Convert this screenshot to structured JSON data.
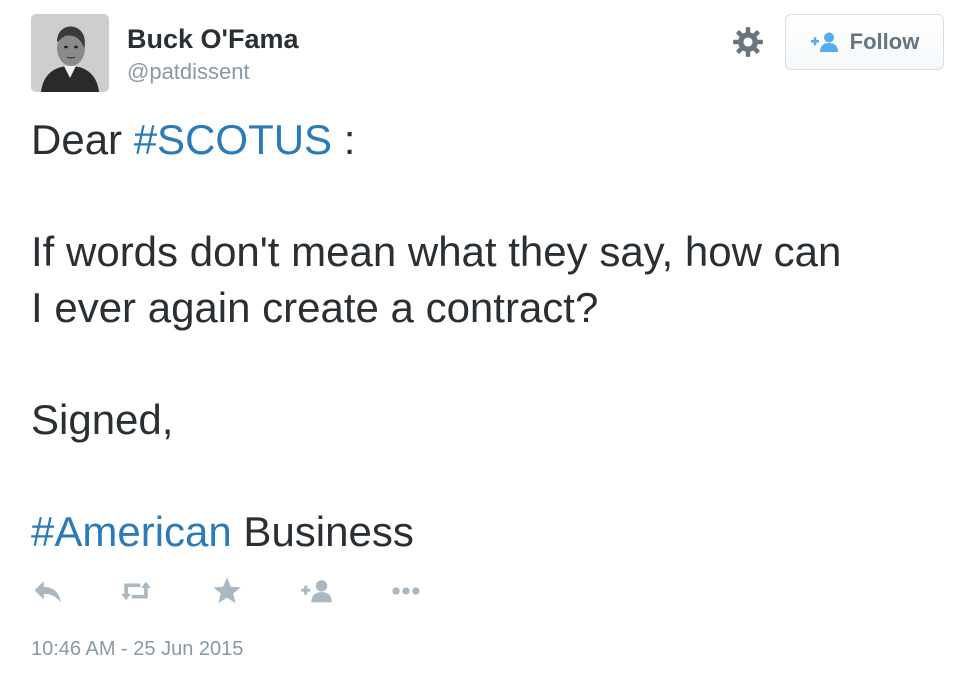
{
  "author": {
    "display_name": "Buck O'Fama",
    "handle": "@patdissent"
  },
  "header": {
    "settings_icon": "gear-icon",
    "follow_label": "Follow",
    "follow_icon": "add-user-icon"
  },
  "tweet": {
    "line1_pre": "Dear ",
    "line1_hashtag": "#SCOTUS",
    "line1_post": " :",
    "line2": "If words don't mean what they say, how can",
    "line3": "I ever again create a contract?",
    "line4": "Signed,",
    "line5_hashtag": "#American",
    "line5_post": " Business"
  },
  "actions": [
    "reply-icon",
    "retweet-icon",
    "favorite-icon",
    "follow-user-icon",
    "more-icon"
  ],
  "timestamp": "10:46 AM - 25 Jun 2015",
  "colors": {
    "link": "#2b7bb9",
    "text": "#292f33",
    "muted": "#8899a6",
    "icon": "#aab8c2"
  }
}
